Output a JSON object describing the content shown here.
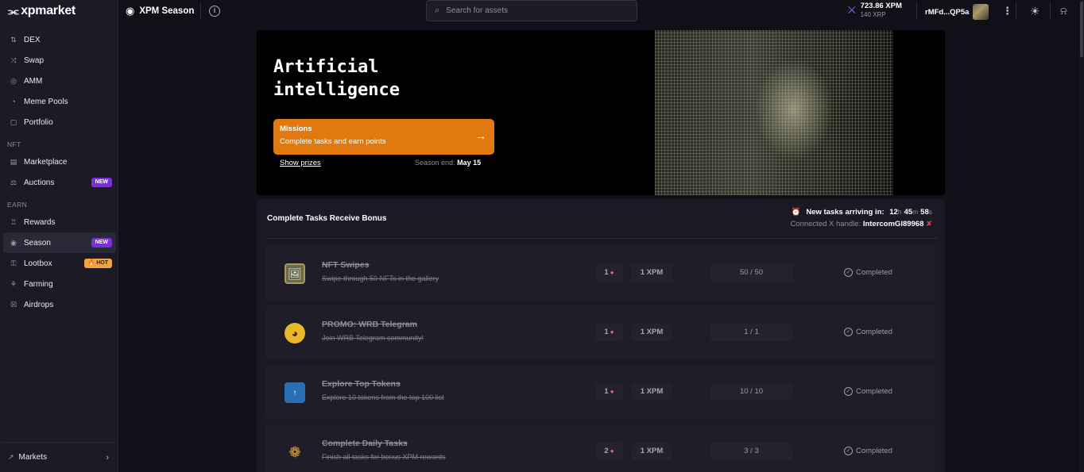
{
  "brand": {
    "logo_text": "xpmarket"
  },
  "sidebar": {
    "main_items": [
      {
        "label": "DEX",
        "icon": "dex-icon"
      },
      {
        "label": "Swap",
        "icon": "swap-icon"
      },
      {
        "label": "AMM",
        "icon": "amm-icon"
      },
      {
        "label": "Meme Pools",
        "icon": "meme-pools-icon"
      },
      {
        "label": "Portfolio",
        "icon": "portfolio-icon"
      }
    ],
    "nft_section": "NFT",
    "nft_items": [
      {
        "label": "Marketplace",
        "icon": "marketplace-icon"
      },
      {
        "label": "Auctions",
        "icon": "auctions-icon",
        "badge": "NEW"
      }
    ],
    "earn_section": "EARN",
    "earn_items": [
      {
        "label": "Rewards",
        "icon": "trophy-icon"
      },
      {
        "label": "Season",
        "icon": "eye-icon",
        "badge": "NEW",
        "active": true
      },
      {
        "label": "Lootbox",
        "icon": "key-icon",
        "badge": "HOT"
      },
      {
        "label": "Farming",
        "icon": "farming-icon"
      },
      {
        "label": "Airdrops",
        "icon": "gift-icon"
      }
    ],
    "markets_label": "Markets"
  },
  "topbar": {
    "page_title": "XPM Season",
    "search_placeholder": "Search for assets",
    "balance": "723.86 XPM",
    "balance_sub": "140 XRP",
    "account": "rMFd...QP5a"
  },
  "hero": {
    "title": "Artificial intelligence",
    "missions_title": "Missions",
    "missions_subtitle": "Complete tasks and earn points",
    "show_prizes": "Show prizes",
    "season_end_label": "Season end:",
    "season_end_date": "May 15"
  },
  "tasks_panel": {
    "title": "Complete Tasks Receive Bonus",
    "new_tasks_label": "New tasks arriving in:",
    "timer_h": "12",
    "timer_m": "45",
    "timer_s": "58",
    "unit_h": "h",
    "unit_m": "m",
    "unit_s": "s",
    "connected_label": "Connected X handle:",
    "connected_handle": "IntercomGI89968",
    "tasks": [
      {
        "name": "NFT Swipes",
        "desc": "Swipe through 50 NFTs in the gallery",
        "points": "1",
        "reward": "1 XPM",
        "progress": "50 / 50",
        "status": "Completed",
        "icon": "nft-image-icon"
      },
      {
        "name": "PROMO: WRB Telegram",
        "desc": "Join WRB Telegram community!",
        "points": "1",
        "reward": "1 XPM",
        "progress": "1 / 1",
        "status": "Completed",
        "icon": "wrb-coin-icon"
      },
      {
        "name": "Explore Top Tokens",
        "desc": "Explore 10 tokens from the top 100 list",
        "points": "1",
        "reward": "1 XPM",
        "progress": "10 / 10",
        "status": "Completed",
        "icon": "top-tokens-icon"
      },
      {
        "name": "Complete Daily Tasks",
        "desc": "Finish all tasks for bonus XPM rewards",
        "points": "2",
        "reward": "1 XPM",
        "progress": "3 / 3",
        "status": "Completed",
        "icon": "medal-icon"
      }
    ]
  },
  "colors": {
    "accent_orange": "#e0790f",
    "badge_new": "#7b2de0",
    "badge_hot": "#f0a340",
    "bg": "#111019"
  }
}
